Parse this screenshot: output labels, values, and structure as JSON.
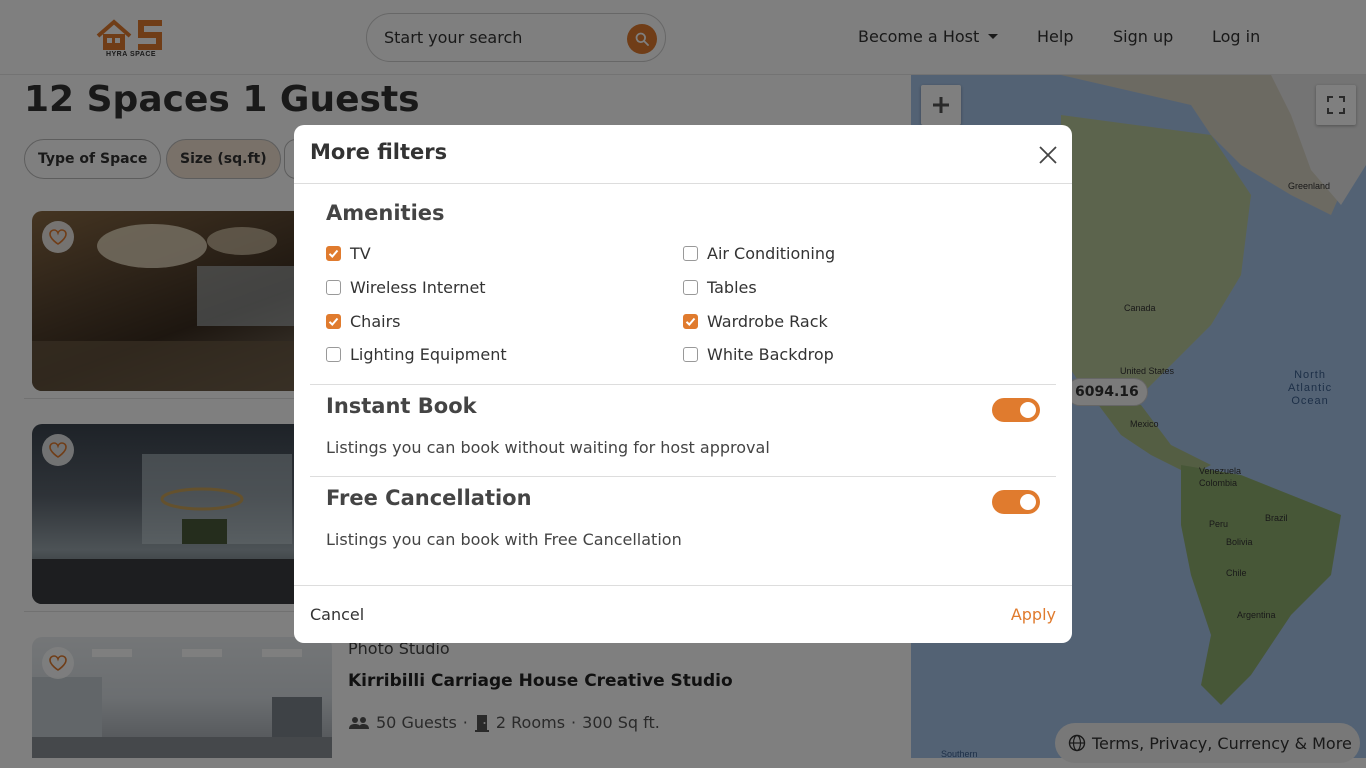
{
  "header": {
    "logo_text": "HYRA SPACE",
    "search_placeholder": "Start your search",
    "nav": {
      "become_host": "Become a Host",
      "help": "Help",
      "sign_up": "Sign up",
      "log_in": "Log in"
    }
  },
  "results": {
    "title": "12 Spaces 1 Guests",
    "filters": [
      "Type of Space",
      "Size (sq.ft)"
    ]
  },
  "listing": {
    "type": "Photo Studio",
    "name": "Kirribilli Carriage House Creative Studio",
    "guests": "50 Guests",
    "rooms": "2 Rooms",
    "size": "300 Sq ft."
  },
  "map": {
    "price_marker": "6094.16",
    "labels": {
      "greenland": "Greenland",
      "canada": "Canada",
      "us": "United States",
      "mexico": "Mexico",
      "venezuela": "Venezuela",
      "colombia": "Colombia",
      "peru": "Peru",
      "brazil": "Brazil",
      "bolivia": "Bolivia",
      "chile": "Chile",
      "argentina": "Argentina",
      "ocean_line1": "North",
      "ocean_line2": "Atlantic",
      "ocean_line3": "Ocean",
      "southern": "Southern"
    },
    "footer": "Terms, Privacy, Currency & More"
  },
  "modal": {
    "title": "More filters",
    "amenities_title": "Amenities",
    "amenities": [
      {
        "label": "TV",
        "checked": true
      },
      {
        "label": "Air Conditioning",
        "checked": false
      },
      {
        "label": "Wireless Internet",
        "checked": false
      },
      {
        "label": "Tables",
        "checked": false
      },
      {
        "label": "Chairs",
        "checked": true
      },
      {
        "label": "Wardrobe Rack",
        "checked": true
      },
      {
        "label": "Lighting Equipment",
        "checked": false
      },
      {
        "label": "White Backdrop",
        "checked": false
      }
    ],
    "instant_book": {
      "title": "Instant Book",
      "description": "Listings you can book without waiting for host approval",
      "enabled": true
    },
    "free_cancellation": {
      "title": "Free Cancellation",
      "description": "Listings you can book with Free Cancellation",
      "enabled": true
    },
    "cancel_label": "Cancel",
    "apply_label": "Apply"
  },
  "colors": {
    "accent": "#e07b2e",
    "overlay": "rgba(0,0,0,0.5)"
  }
}
